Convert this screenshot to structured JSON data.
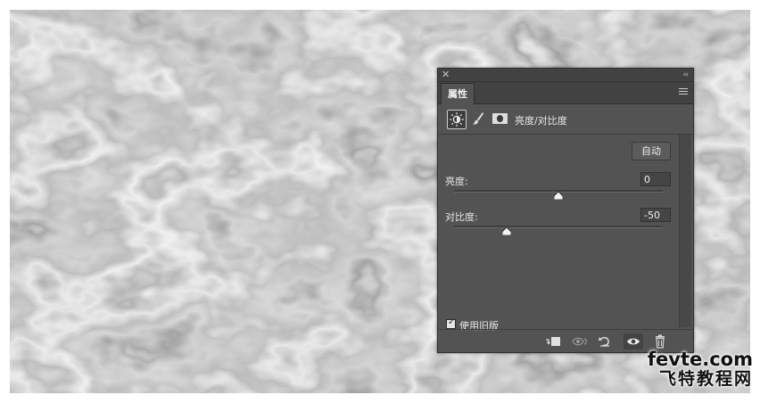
{
  "panel": {
    "tab_label": "属性",
    "adjustment_title": "亮度/对比度",
    "auto_button": "自动",
    "brightness": {
      "label": "亮度:",
      "value": "0",
      "level": 0.5
    },
    "contrast": {
      "label": "对比度:",
      "value": "-50",
      "level": 0.25
    },
    "legacy": {
      "label": "使用旧版",
      "checked": true
    }
  },
  "icons": {
    "header": [
      "brightness-contrast-icon",
      "brush-icon",
      "mask-icon"
    ],
    "footer": [
      "clip-to-layer-icon",
      "view-previous-icon",
      "reset-icon",
      "visibility-icon",
      "trash-icon"
    ]
  },
  "watermark": {
    "url": "fevte.com",
    "site": "飞特教程网"
  }
}
